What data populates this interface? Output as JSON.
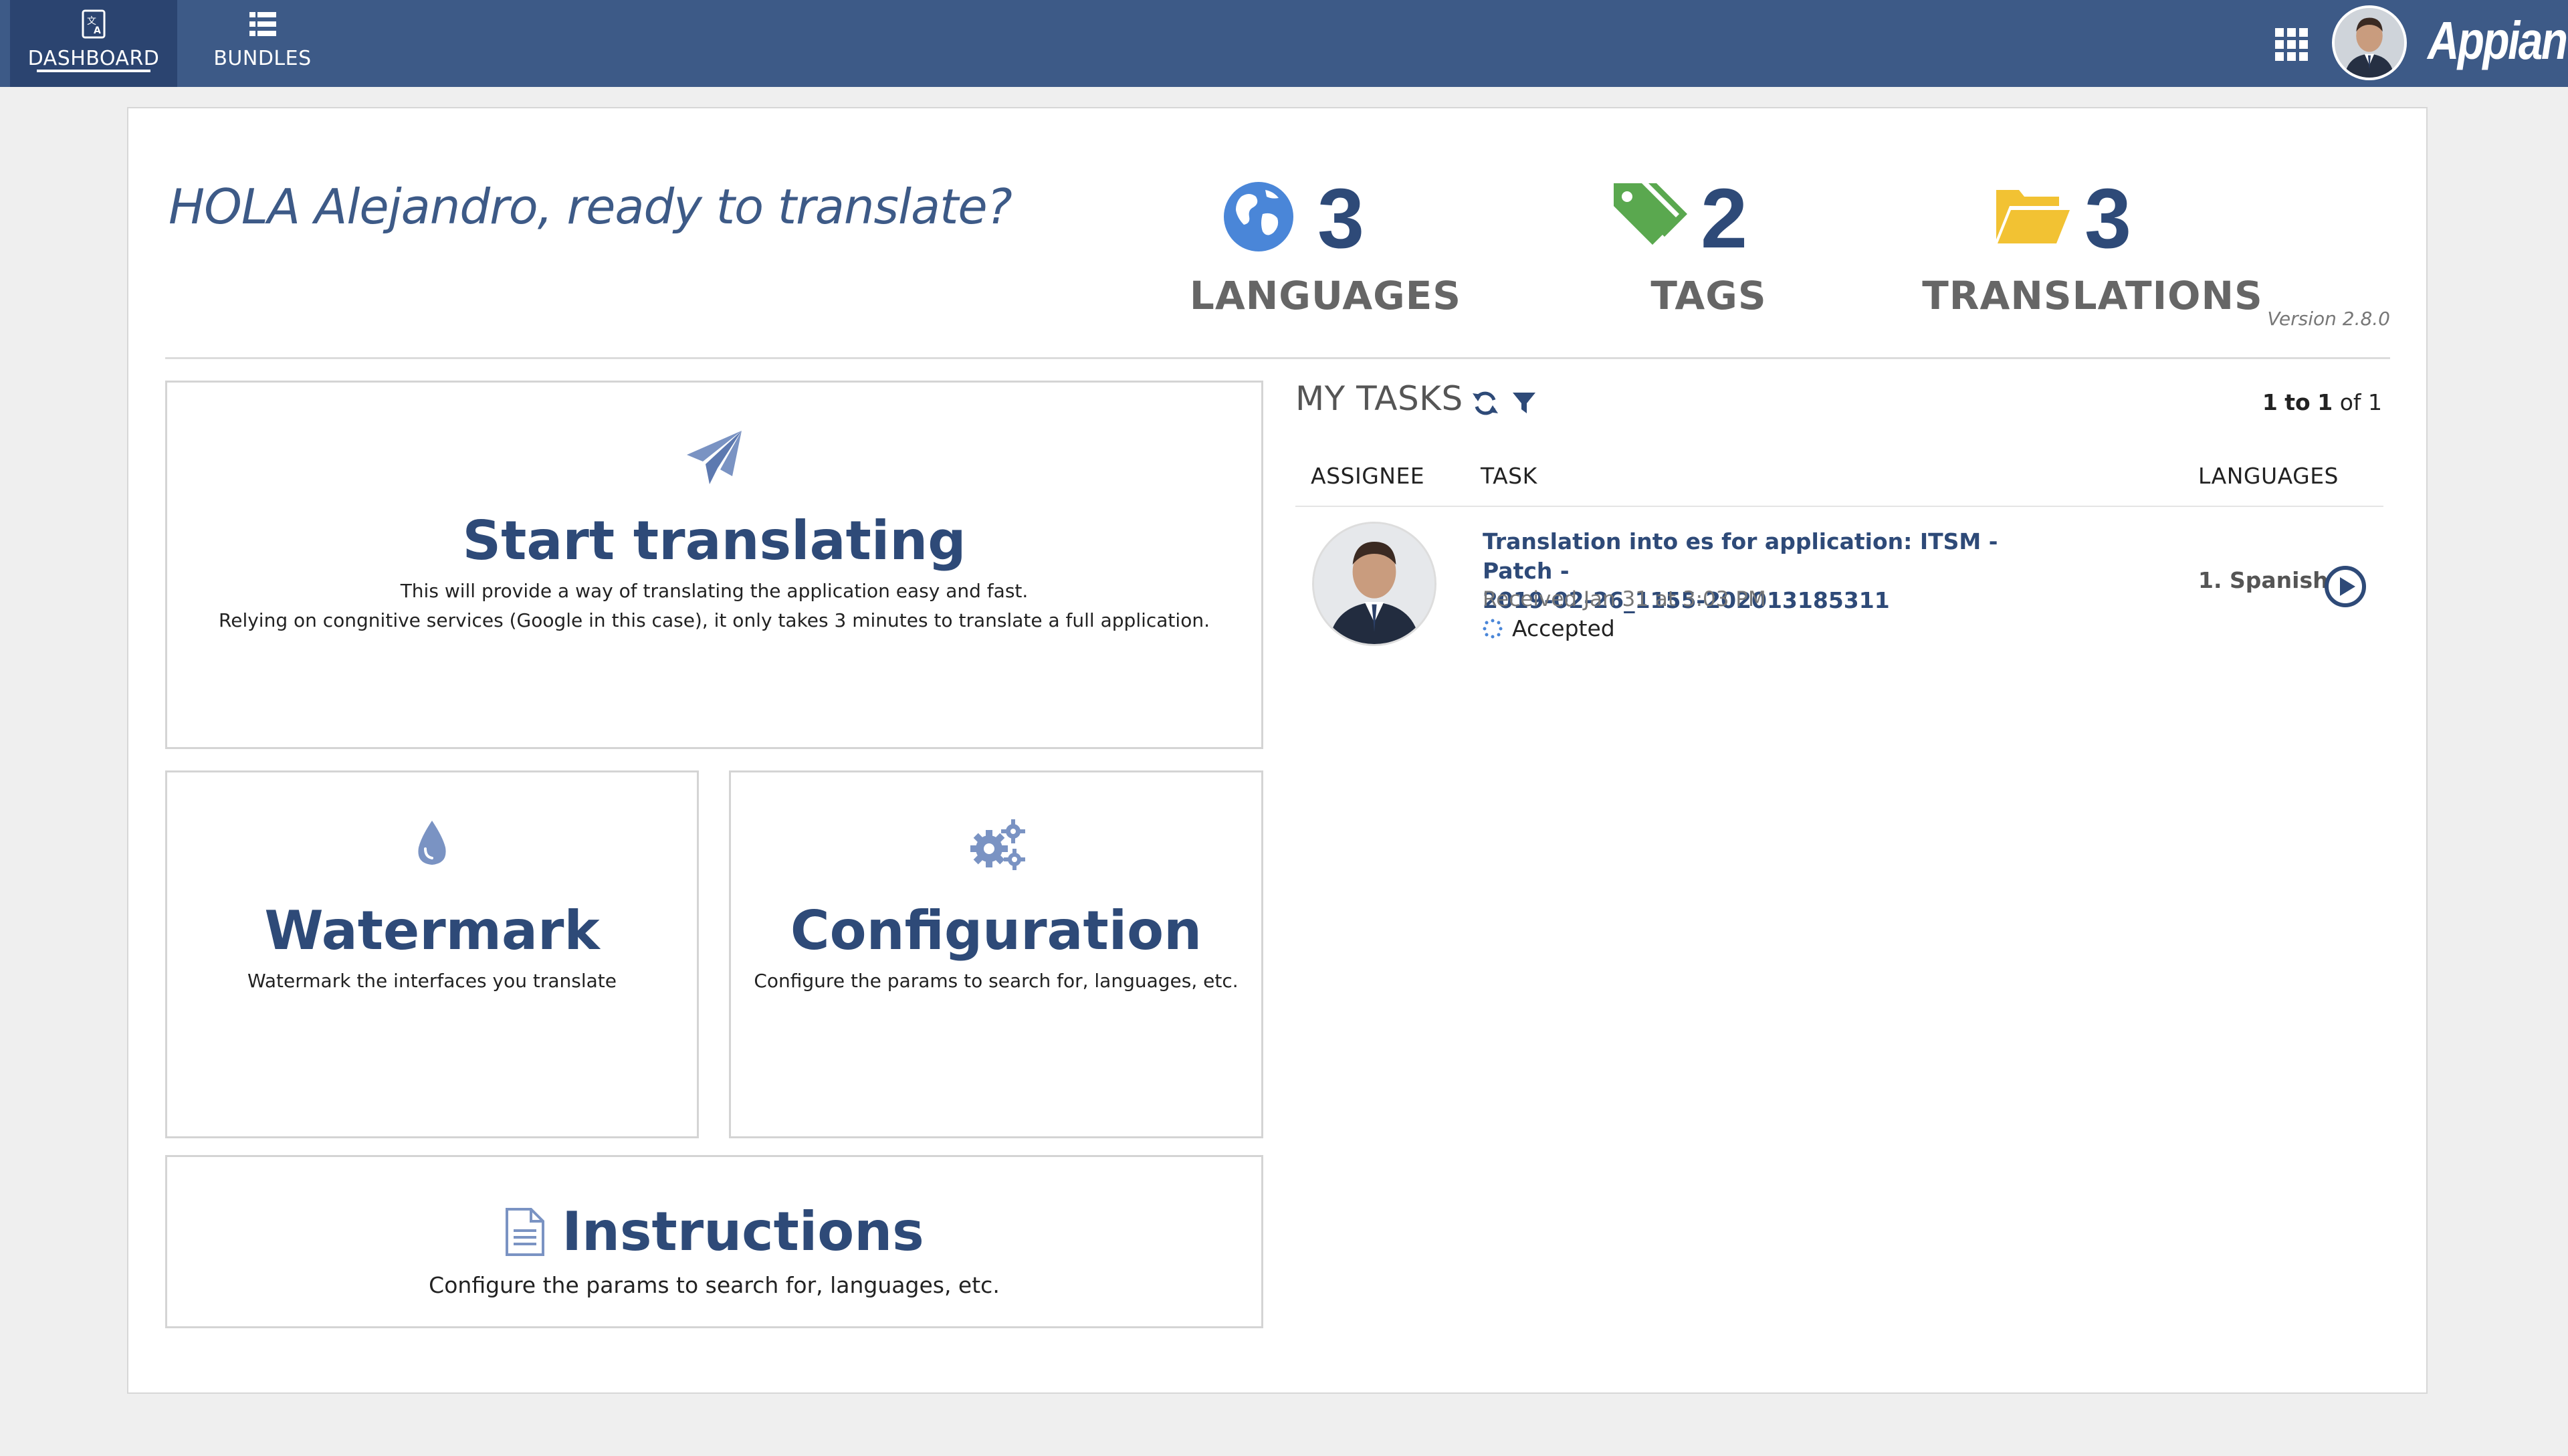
{
  "nav": {
    "tabs": [
      {
        "label": "DASHBOARD",
        "icon": "translate-book-icon",
        "active": true
      },
      {
        "label": "BUNDLES",
        "icon": "list-icon",
        "active": false
      }
    ],
    "brand": "Appian",
    "accent_color": "#3d5a87"
  },
  "header": {
    "greeting": "HOLA Alejandro, ready to translate?",
    "version": "Version 2.8.0",
    "stats": [
      {
        "number": "3",
        "label": "LANGUAGES",
        "icon": "globe-icon",
        "color": "#4a86d8"
      },
      {
        "number": "2",
        "label": "TAGS",
        "icon": "tags-icon",
        "color": "#5aa84f"
      },
      {
        "number": "3",
        "label": "TRANSLATIONS",
        "icon": "folder-open-icon",
        "color": "#f2c233"
      }
    ]
  },
  "tiles": {
    "start": {
      "title": "Start translating",
      "line1": "This will provide a way of translating the application easy and fast.",
      "line2": "Relying on congnitive services (Google in this case), it only takes 3 minutes to translate a full application.",
      "icon": "paper-plane-icon"
    },
    "watermark": {
      "title": "Watermark",
      "text": "Watermark the interfaces you translate",
      "icon": "droplet-icon"
    },
    "configuration": {
      "title": "Configuration",
      "text": "Configure the params to search for, languages, etc.",
      "icon": "gears-icon"
    },
    "instructions": {
      "title": "Instructions",
      "text": "Configure the params to search for, languages, etc.",
      "icon": "document-icon"
    }
  },
  "tasks": {
    "title": "MY TASKS",
    "pager": {
      "from": "1",
      "to_word": "to",
      "to": "1",
      "of_text": "of 1"
    },
    "columns": {
      "assignee": "ASSIGNEE",
      "task": "TASK",
      "languages": "LANGUAGES"
    },
    "rows": [
      {
        "task_line1": "Translation into es for application: ITSM - Patch -",
        "task_line2": "2019-02-26_1155-202013185311",
        "received": "Received Jan 31 at 3:03 PM",
        "status": "Accepted",
        "language": "1. Spanish"
      }
    ]
  }
}
